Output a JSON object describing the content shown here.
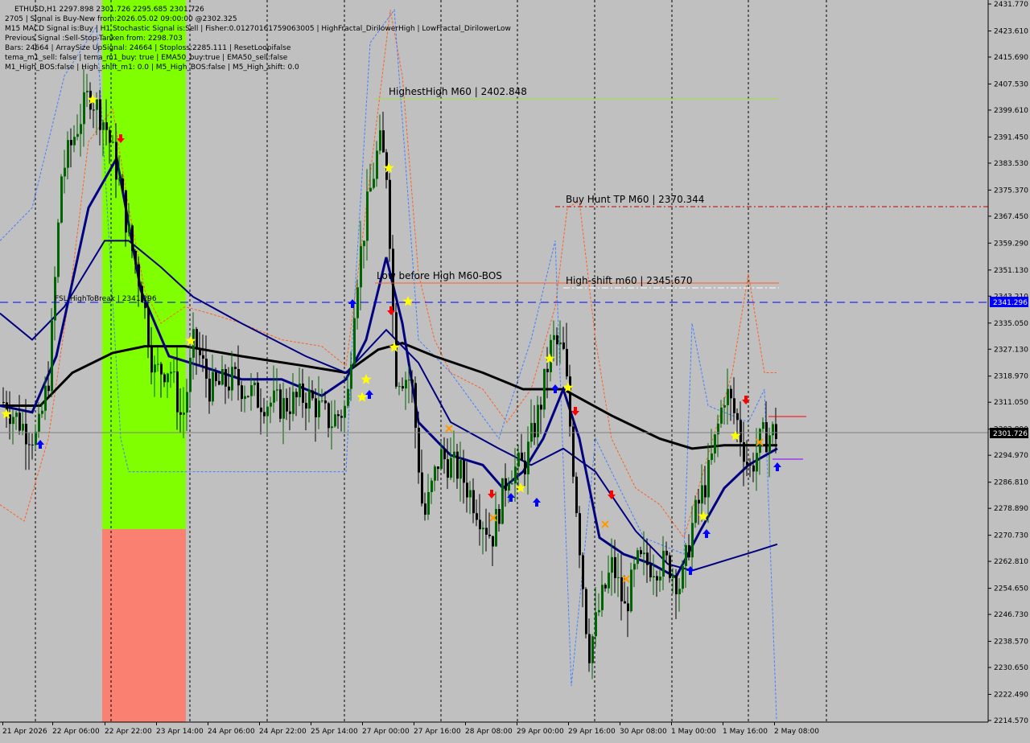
{
  "header": {
    "symbol_line": "ETHUSD,H1  2297.898 2301.726 2295.685 2301.726",
    "info_lines": [
      "2705 | Signal is Buy-New from:2026.05.02 09:00:00 @2302.325",
      "M15 MACD Signal is:Buy | H1 Stochastic Signal is:Sell | Fisher:0.01270161759063005 | HighFractal_DirilowerHigh | LowFractal_DirilowerLow",
      "Previous Signal :Sell-Stop-Tanken from: 2298.703",
      "Bars: 24664 | ArraySize UpSignal: 24664 | Stoploss:2285.111 | ResetLoopifalse",
      "tema_m1_sell: false | tema_m1_buy: true | EMA50_buy:true | EMA50_sell:false",
      "M1_High_BOS:false | High_shift_m1: 0.0 | M5_High_BOS:false | M5_High_shift: 0.0"
    ]
  },
  "price_axis": {
    "ticks": [
      "2431.770",
      "2423.610",
      "2415.690",
      "2407.530",
      "2399.610",
      "2391.450",
      "2383.530",
      "2375.370",
      "2367.450",
      "2359.290",
      "2351.130",
      "2343.210",
      "2335.050",
      "2327.130",
      "2318.970",
      "2311.050",
      "2302.890",
      "2294.970",
      "2286.810",
      "2278.890",
      "2270.730",
      "2262.810",
      "2254.650",
      "2246.730",
      "2238.570",
      "2230.650",
      "2222.490",
      "2214.570"
    ],
    "top_value": 2431.77,
    "bottom_value": 2214.57,
    "current_price_label": "2301.726",
    "current_price": 2301.726,
    "level_label": "2341.296",
    "level_price": 2341.296,
    "current_color": "#000000",
    "level_color": "#0000ff"
  },
  "time_axis": {
    "labels": [
      "21 Apr 2026",
      "22 Apr 06:00",
      "22 Apr 22:00",
      "23 Apr 14:00",
      "24 Apr 06:00",
      "24 Apr 22:00",
      "25 Apr 14:00",
      "27 Apr 00:00",
      "27 Apr 16:00",
      "28 Apr 08:00",
      "29 Apr 00:00",
      "29 Apr 16:00",
      "30 Apr 08:00",
      "1 May 00:00",
      "1 May 16:00",
      "2 May 08:00"
    ]
  },
  "objects": {
    "highest_high": {
      "label": "HighestHigh   M60 | 2402.848",
      "price": 2402.848,
      "color": "#a0e040"
    },
    "buy_hunt_tp": {
      "label": "Buy Hunt TP M60 | 2370.344",
      "price": 2370.344,
      "color": "#c00000"
    },
    "high_shift": {
      "label": "High-shift m60 | 2345.670",
      "price": 2345.67,
      "color": "#ff6020"
    },
    "low_before_high": {
      "label": "Low before High   M60-BOS",
      "price": 2347.0,
      "color": "#ff6020"
    },
    "fsl_high": {
      "label": "FSL-HighToBreak | 2341.296",
      "price": 2341.296
    }
  },
  "colors": {
    "background": "#c0c0c0",
    "candle_up": "#006400",
    "candle_down": "#000000",
    "zone_buy": "#80ff00",
    "zone_sell": "#fa8072",
    "ema_thick": "#000000",
    "ma_blue": "#000080",
    "orange_env": "#ff6020",
    "blue_env": "#4080ff",
    "star": "#ffff00",
    "arrow_up": "#0000ff",
    "arrow_down": "#ff0000"
  }
}
